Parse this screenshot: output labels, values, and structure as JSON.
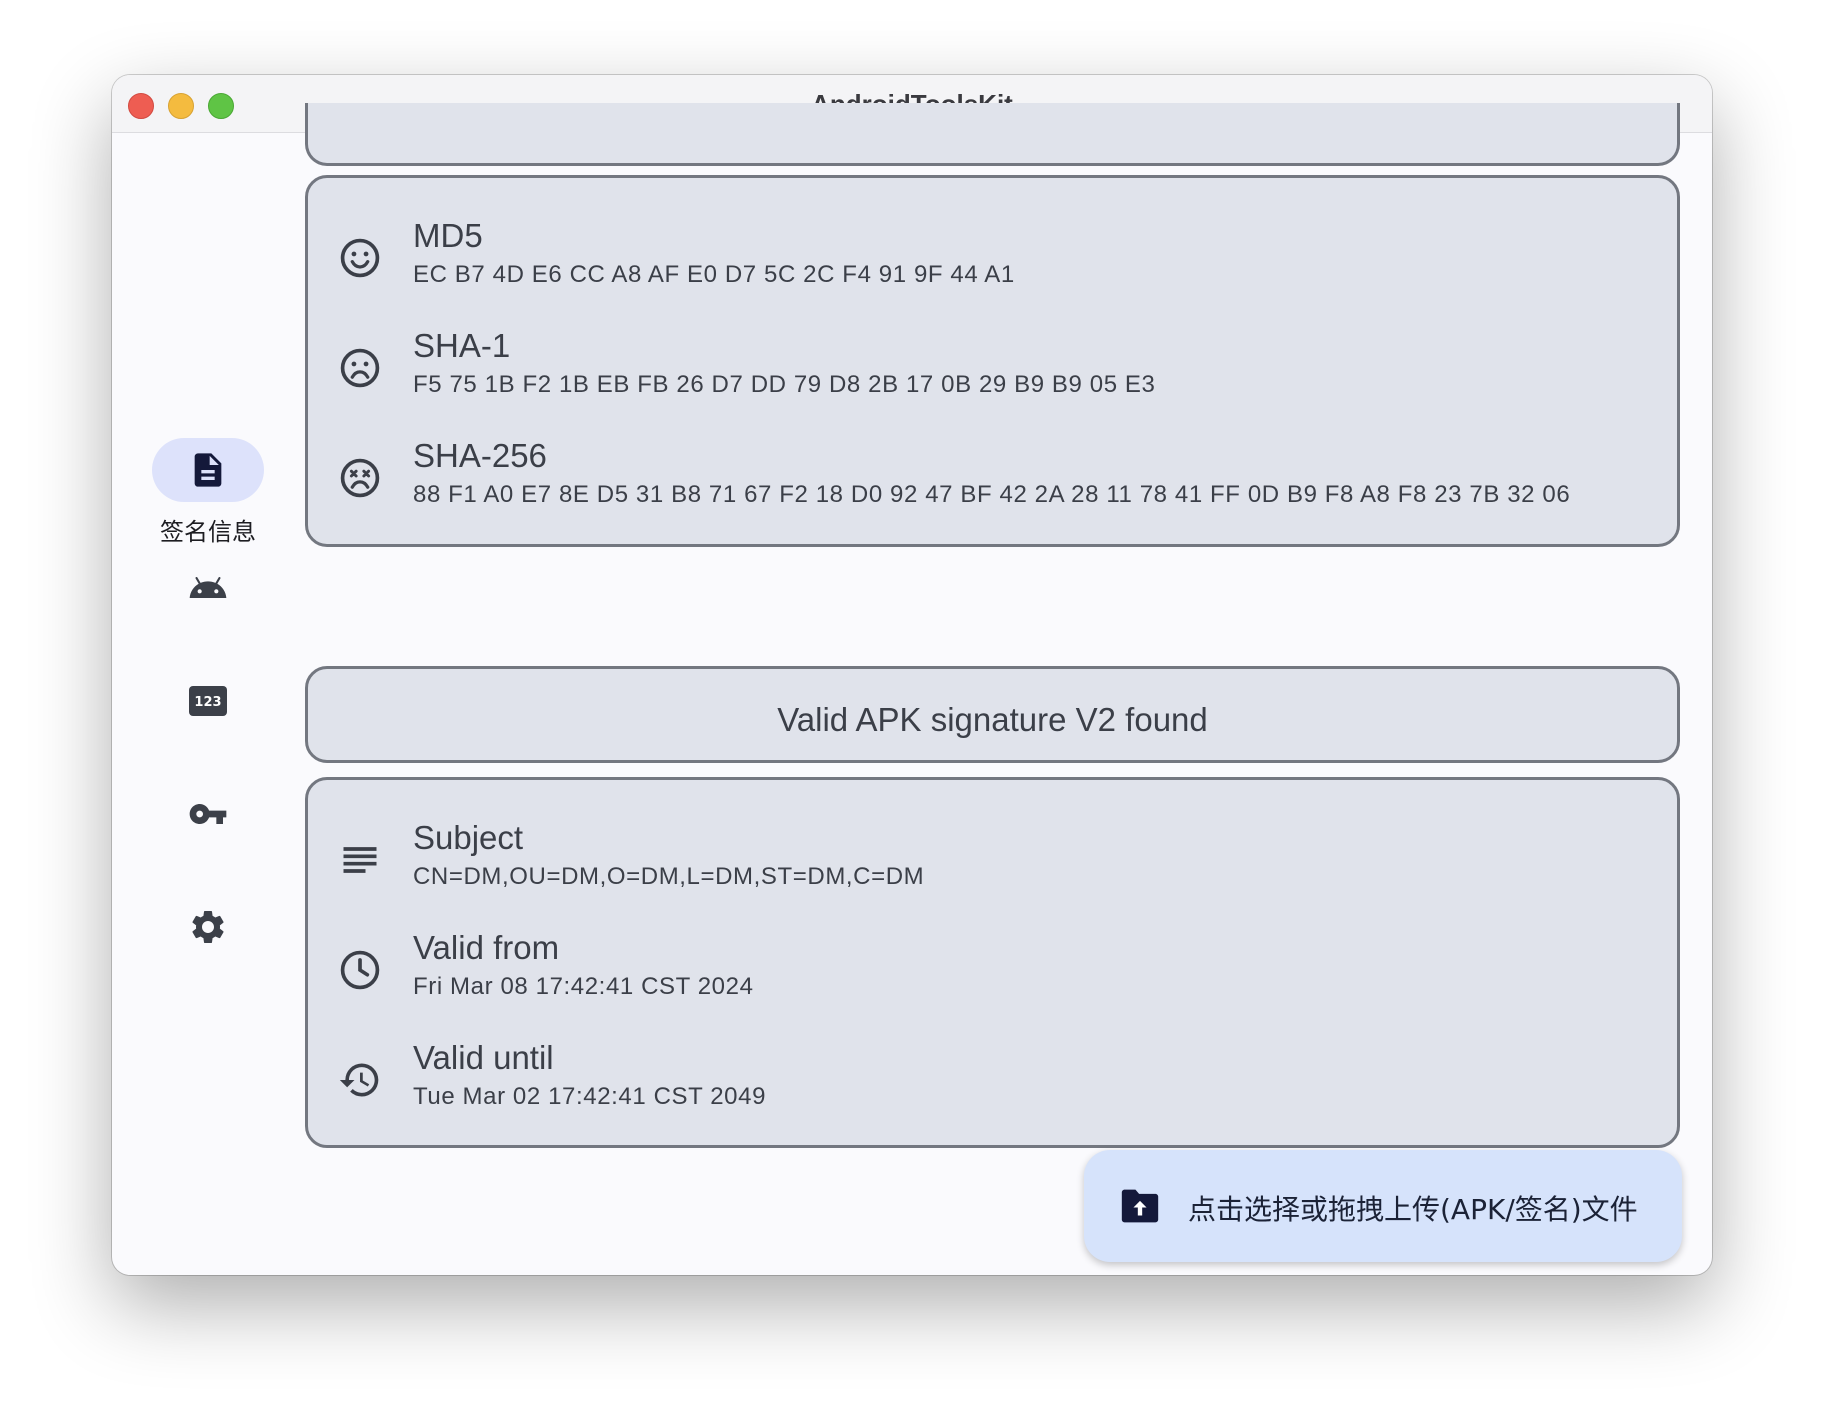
{
  "window": {
    "title": "AndroidToolsKit"
  },
  "rail": {
    "items": [
      {
        "label": "签名信息",
        "icon": "document-icon",
        "selected": true
      },
      {
        "label": "",
        "icon": "android-icon",
        "selected": false
      },
      {
        "label": "",
        "icon": "numbers-123-icon",
        "selected": false
      },
      {
        "label": "",
        "icon": "key-icon",
        "selected": false
      },
      {
        "label": "",
        "icon": "gear-icon",
        "selected": false
      }
    ]
  },
  "fingerprints": {
    "rows": [
      {
        "title": "MD5",
        "value": "EC B7 4D E6 CC A8 AF E0 D7 5C 2C F4 91 9F 44 A1",
        "icon": "smile-face-icon"
      },
      {
        "title": "SHA-1",
        "value": "F5 75 1B F2 1B EB FB 26 D7 DD 79 D8 2B 17 0B 29 B9 B9 05 E3",
        "icon": "sad-face-icon"
      },
      {
        "title": "SHA-256",
        "value": "88 F1 A0 E7 8E D5 31 B8 71 67 F2 18 D0 92 47 BF 42 2A 28 11 78 41 FF 0D B9 F8 A8 F8 23 7B 32 06",
        "icon": "dizzy-face-icon"
      }
    ]
  },
  "signature_banner": {
    "text": "Valid APK signature V2 found"
  },
  "certificate": {
    "rows": [
      {
        "title": "Subject",
        "value": "CN=DM,OU=DM,O=DM,L=DM,ST=DM,C=DM",
        "icon": "lines-icon"
      },
      {
        "title": "Valid from",
        "value": "Fri Mar 08 17:42:41 CST 2024",
        "icon": "clock-icon"
      },
      {
        "title": "Valid until",
        "value": "Tue Mar 02 17:42:41 CST 2049",
        "icon": "history-icon"
      }
    ]
  },
  "fab": {
    "label": "点击选择或拖拽上传(APK/签名)文件",
    "icon": "folder-upload-icon"
  },
  "colors": {
    "card_bg": "#e0e3eb",
    "card_border": "#737780",
    "rail_indicator": "#dde2fb",
    "fab_bg": "#d6e3fb",
    "text": "#3b3f48"
  }
}
